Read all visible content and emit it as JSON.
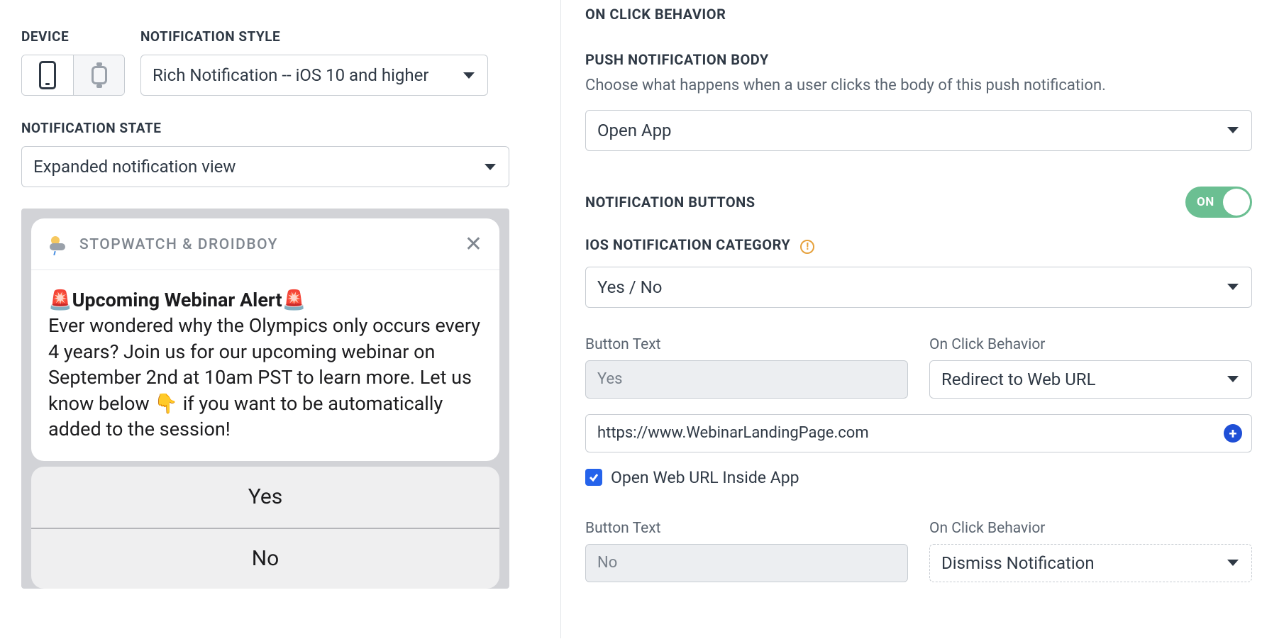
{
  "left": {
    "device_label": "DEVICE",
    "notif_style_label": "NOTIFICATION STYLE",
    "notif_style_value": "Rich Notification -- iOS 10 and higher",
    "notif_state_label": "NOTIFICATION STATE",
    "notif_state_value": "Expanded notification view"
  },
  "preview": {
    "app_name": "STOPWATCH & DROIDBOY",
    "title": "🚨Upcoming Webinar Alert🚨",
    "body": "Ever wondered why the Olympics only occurs every 4 years? Join us for our upcoming webinar on September 2nd at 10am PST to learn more. Let us know below 👇 if you want to be automatically added to the session!",
    "action_yes": "Yes",
    "action_no": "No"
  },
  "right": {
    "on_click_heading": "ON CLICK BEHAVIOR",
    "push_body_heading": "PUSH NOTIFICATION BODY",
    "push_body_desc": "Choose what happens when a user clicks the body of this push notification.",
    "push_body_value": "Open App",
    "notif_buttons_heading": "NOTIFICATION BUTTONS",
    "toggle_label": "ON",
    "ios_category_heading": "IOS NOTIFICATION CATEGORY",
    "ios_category_value": "Yes / No",
    "button_text_label": "Button Text",
    "on_click_label": "On Click Behavior",
    "btn1_text": "Yes",
    "btn1_behavior": "Redirect to Web URL",
    "btn1_url": "https://www.WebinarLandingPage.com",
    "open_inside_label": "Open Web URL Inside App",
    "btn2_text": "No",
    "btn2_behavior": "Dismiss Notification"
  }
}
